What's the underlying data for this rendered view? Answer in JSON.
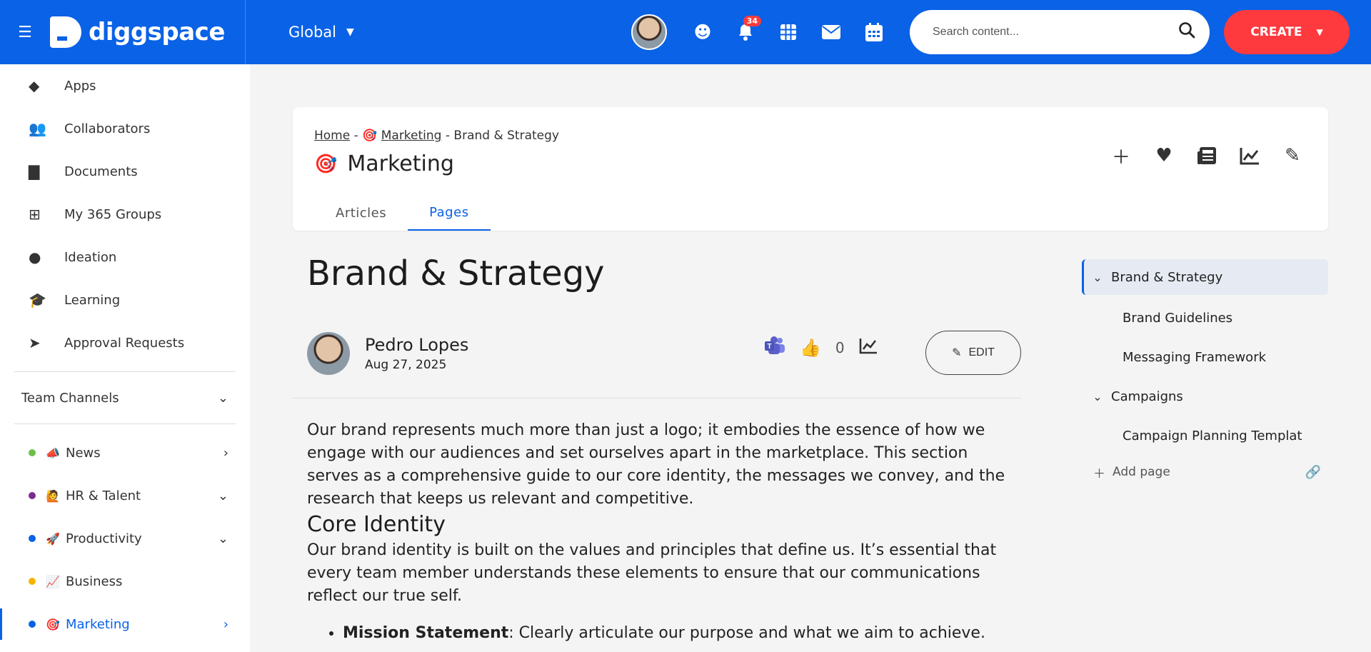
{
  "topbar": {
    "logo_text": "diggspace",
    "scope": "Global",
    "notification_count": "34",
    "search_placeholder": "Search content...",
    "create_label": "CREATE"
  },
  "sidebar": {
    "items": [
      {
        "label": "Apps",
        "icon": "apps-icon"
      },
      {
        "label": "Collaborators",
        "icon": "users-icon"
      },
      {
        "label": "Documents",
        "icon": "document-icon"
      },
      {
        "label": "My 365 Groups",
        "icon": "groups-icon"
      },
      {
        "label": "Ideation",
        "icon": "lightbulb-icon"
      },
      {
        "label": "Learning",
        "icon": "graduation-cap-icon"
      },
      {
        "label": "Approval Requests",
        "icon": "paper-plane-icon"
      }
    ],
    "team_channels_label": "Team Channels",
    "channels": [
      {
        "label": "News",
        "emoji": "📣",
        "color": "#6cc04a"
      },
      {
        "label": "HR & Talent",
        "emoji": "🙋",
        "color": "#7b2d8b"
      },
      {
        "label": "Productivity",
        "emoji": "🚀",
        "color": "#0a62e6"
      },
      {
        "label": "Business",
        "emoji": "📈",
        "color": "#f5b400"
      },
      {
        "label": "Marketing",
        "emoji": "🎯",
        "color": "#0a62e6"
      }
    ]
  },
  "header": {
    "breadcrumb_home": "Home",
    "breadcrumb_marketing": "Marketing",
    "breadcrumb_current": "Brand & Strategy",
    "title": "Marketing",
    "title_emoji": "🎯",
    "tabs": [
      "Articles",
      "Pages"
    ]
  },
  "article": {
    "title": "Brand & Strategy",
    "author": "Pedro Lopes",
    "date": "Aug 27, 2025",
    "likes": "0",
    "edit_label": "EDIT",
    "intro": "Our brand represents much more than just a logo; it embodies the essence of how we engage with our audiences and set ourselves apart in the marketplace. This section serves as a comprehensive guide to our core identity, the messages we convey, and the research that keeps us relevant and competitive.",
    "section_title": "Core Identity",
    "section_text": "Our brand identity is built on the values and principles that define us. It’s essential that every team member understands these elements to ensure that our communications reflect our true self.",
    "bullet_term": "Mission Statement",
    "bullet_text": ": Clearly articulate our purpose and what we aim to achieve."
  },
  "tree": {
    "items": [
      {
        "label": "Brand & Strategy"
      },
      {
        "label": "Brand Guidelines"
      },
      {
        "label": "Messaging Framework"
      },
      {
        "label": "Campaigns"
      },
      {
        "label": "Campaign Planning Templat"
      }
    ],
    "add_page_label": "Add page"
  }
}
